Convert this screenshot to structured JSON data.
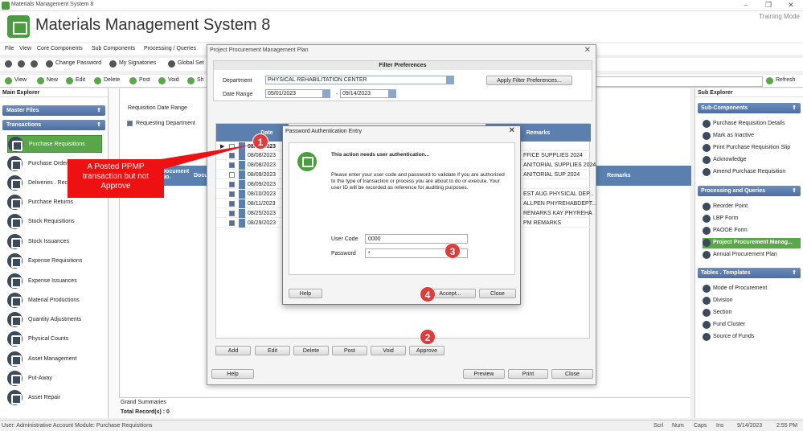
{
  "window": {
    "title": "Materials Management System 8",
    "app_name": "Materials Management System 8",
    "mode": "Training Mode"
  },
  "menu": [
    "File",
    "View",
    "Core Components",
    "Sub Components",
    "Processing / Queries"
  ],
  "toolbar1": {
    "change_password": "Change Password",
    "my_signatories": "My Signatories",
    "global_settings": "Global Set"
  },
  "toolbar2": {
    "view": "View",
    "new": "New",
    "edit": "Edit",
    "delete": "Delete",
    "post": "Post",
    "void": "Void",
    "show": "Sh",
    "refresh": "Refresh"
  },
  "main_explorer": {
    "title": "Main Explorer",
    "master_files": "Master Files",
    "transactions": "Transactions",
    "items": [
      "Purchase Requisitions",
      "Purchase Orders",
      "Deliveries . Receiving",
      "Purchase Returns",
      "Stock Requisitions",
      "Stock Issuances",
      "Expense Requisitions",
      "Expense Issuances",
      "Material Productions",
      "Quantity Adjustments",
      "Physical Counts",
      "Asset Management",
      "Put-Away",
      "Asset Repair"
    ]
  },
  "center": {
    "requisition_date_range": "Requisition Date Range",
    "requesting_department": "Requesting Department",
    "document_no_header": "Document No.",
    "doc_header": "Docu",
    "remarks_header": "Remarks",
    "grand_summaries": "Grand Summaries",
    "total_records": "Total Record(s) : 0"
  },
  "sub_explorer": {
    "title": "Sub Explorer",
    "sub_components": "Sub-Components",
    "sub_items": [
      "Purchase Requisition Details",
      "Mark as Inactive",
      "Print Purchase Requisition Slip",
      "Acknowledge",
      "Amend Purchase Requisition"
    ],
    "processing": "Processing and Queries",
    "proc_items": [
      "Reorder Point",
      "LBP Form",
      "PAOOE Form",
      "Project Procurement Manag...",
      "Annual Procurement Plan"
    ],
    "tables": "Tables . Templates",
    "table_items": [
      "Mode of Procurement",
      "Division",
      "Section",
      "Fund Cluster",
      "Source of Funds"
    ]
  },
  "ppmp_dialog": {
    "title": "Project Procurement Management Plan",
    "filter_title": "Filter Preferences",
    "department_label": "Department",
    "department_value": "PHYSICAL REHABILITATION CENTER",
    "date_range_label": "Date Range",
    "date_from": "05/01/2023",
    "date_sep": "-",
    "date_to": "09/14/2023",
    "apply_button": "Apply Filter Preferences...",
    "col_date": "Date",
    "col_remarks": "Remarks",
    "rows": [
      {
        "date": "08/0_/2023",
        "remarks": "",
        "checked": false
      },
      {
        "date": "08/08/2023",
        "remarks": "FFICE SUPPLIES 2024",
        "checked": true
      },
      {
        "date": "08/08/2023",
        "remarks": "ANITORIAL SUPPLIES 2024",
        "checked": true
      },
      {
        "date": "08/09/2023",
        "remarks": "ANITORIAL SUP 2024",
        "checked": false
      },
      {
        "date": "08/09/2023",
        "remarks": "",
        "checked": true
      },
      {
        "date": "08/10/2023",
        "remarks": "EST AUG PHYSICAL DEP...",
        "checked": true
      },
      {
        "date": "08/11/2023",
        "remarks": "ALLPEN PHYREHABDEPT...",
        "checked": true
      },
      {
        "date": "08/25/2023",
        "remarks": "REMARKS KAY PHYREHA",
        "checked": true
      },
      {
        "date": "08/29/2023",
        "remarks": "PM REMARKS",
        "checked": true
      }
    ],
    "buttons": {
      "add": "Add",
      "edit": "Edit",
      "delete": "Delete",
      "post": "Post",
      "void": "Void",
      "approve": "Approve",
      "help": "Help",
      "preview": "Preview",
      "print": "Print",
      "close": "Close"
    }
  },
  "auth_dialog": {
    "title": "Password Authentication Entry",
    "heading": "This action needs user authentication...",
    "message": "Please enter your user code and password to validate if you are authorized to the type of transaction or process you are about to do or execute. Your user ID will be recorded as reference for auditing purposes.",
    "user_code_label": "User Code",
    "user_code_value": "0000",
    "password_label": "Password",
    "password_value": "*",
    "help": "Help",
    "accept": "Accept...",
    "close": "Close"
  },
  "callout": "A  Posted PPMP transaction but not Approve",
  "markers": [
    "1",
    "2",
    "3",
    "4"
  ],
  "status": {
    "user": "User: Administrative Account  Module: Purchase Requisitions",
    "scrl": "Scrl",
    "num": "Num",
    "caps": "Caps",
    "ins": "Ins",
    "date": "9/14/2023",
    "time": "2:55 PM"
  },
  "colors": {
    "accent_green": "#5aa64a",
    "header_blue": "#5b7fae",
    "marker_red": "#e03a3a"
  }
}
